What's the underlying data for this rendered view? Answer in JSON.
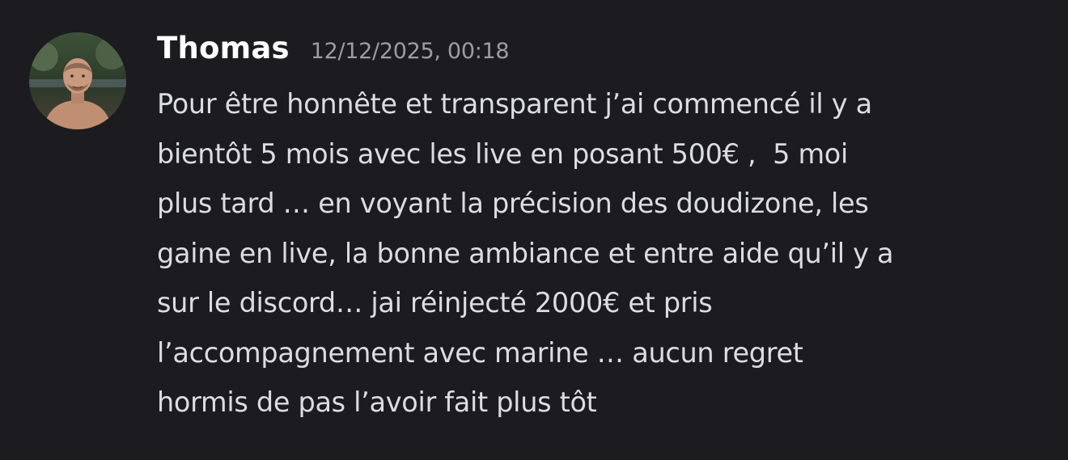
{
  "message": {
    "author": "Thomas",
    "timestamp": "12/12/2025, 00:18",
    "avatar_icon": "user-avatar-photo",
    "lines": [
      "Pour être honnête et transparent j’ai commencé il y a",
      "bientôt 5 mois avec les live en posant 500€ ,  5 moi",
      "plus tard … en voyant la précision des doudizone, les",
      "gaine en live, la bonne ambiance et entre aide qu’il y a",
      "sur le discord… jai réinjecté 2000€ et pris",
      "l’accompagnement avec marine … aucun regret",
      "hormis de pas l’avoir fait plus tôt"
    ]
  },
  "colors": {
    "background": "#1c1c20",
    "username": "#ffffff",
    "timestamp": "#9c9ca6",
    "text": "#dcdde1"
  }
}
